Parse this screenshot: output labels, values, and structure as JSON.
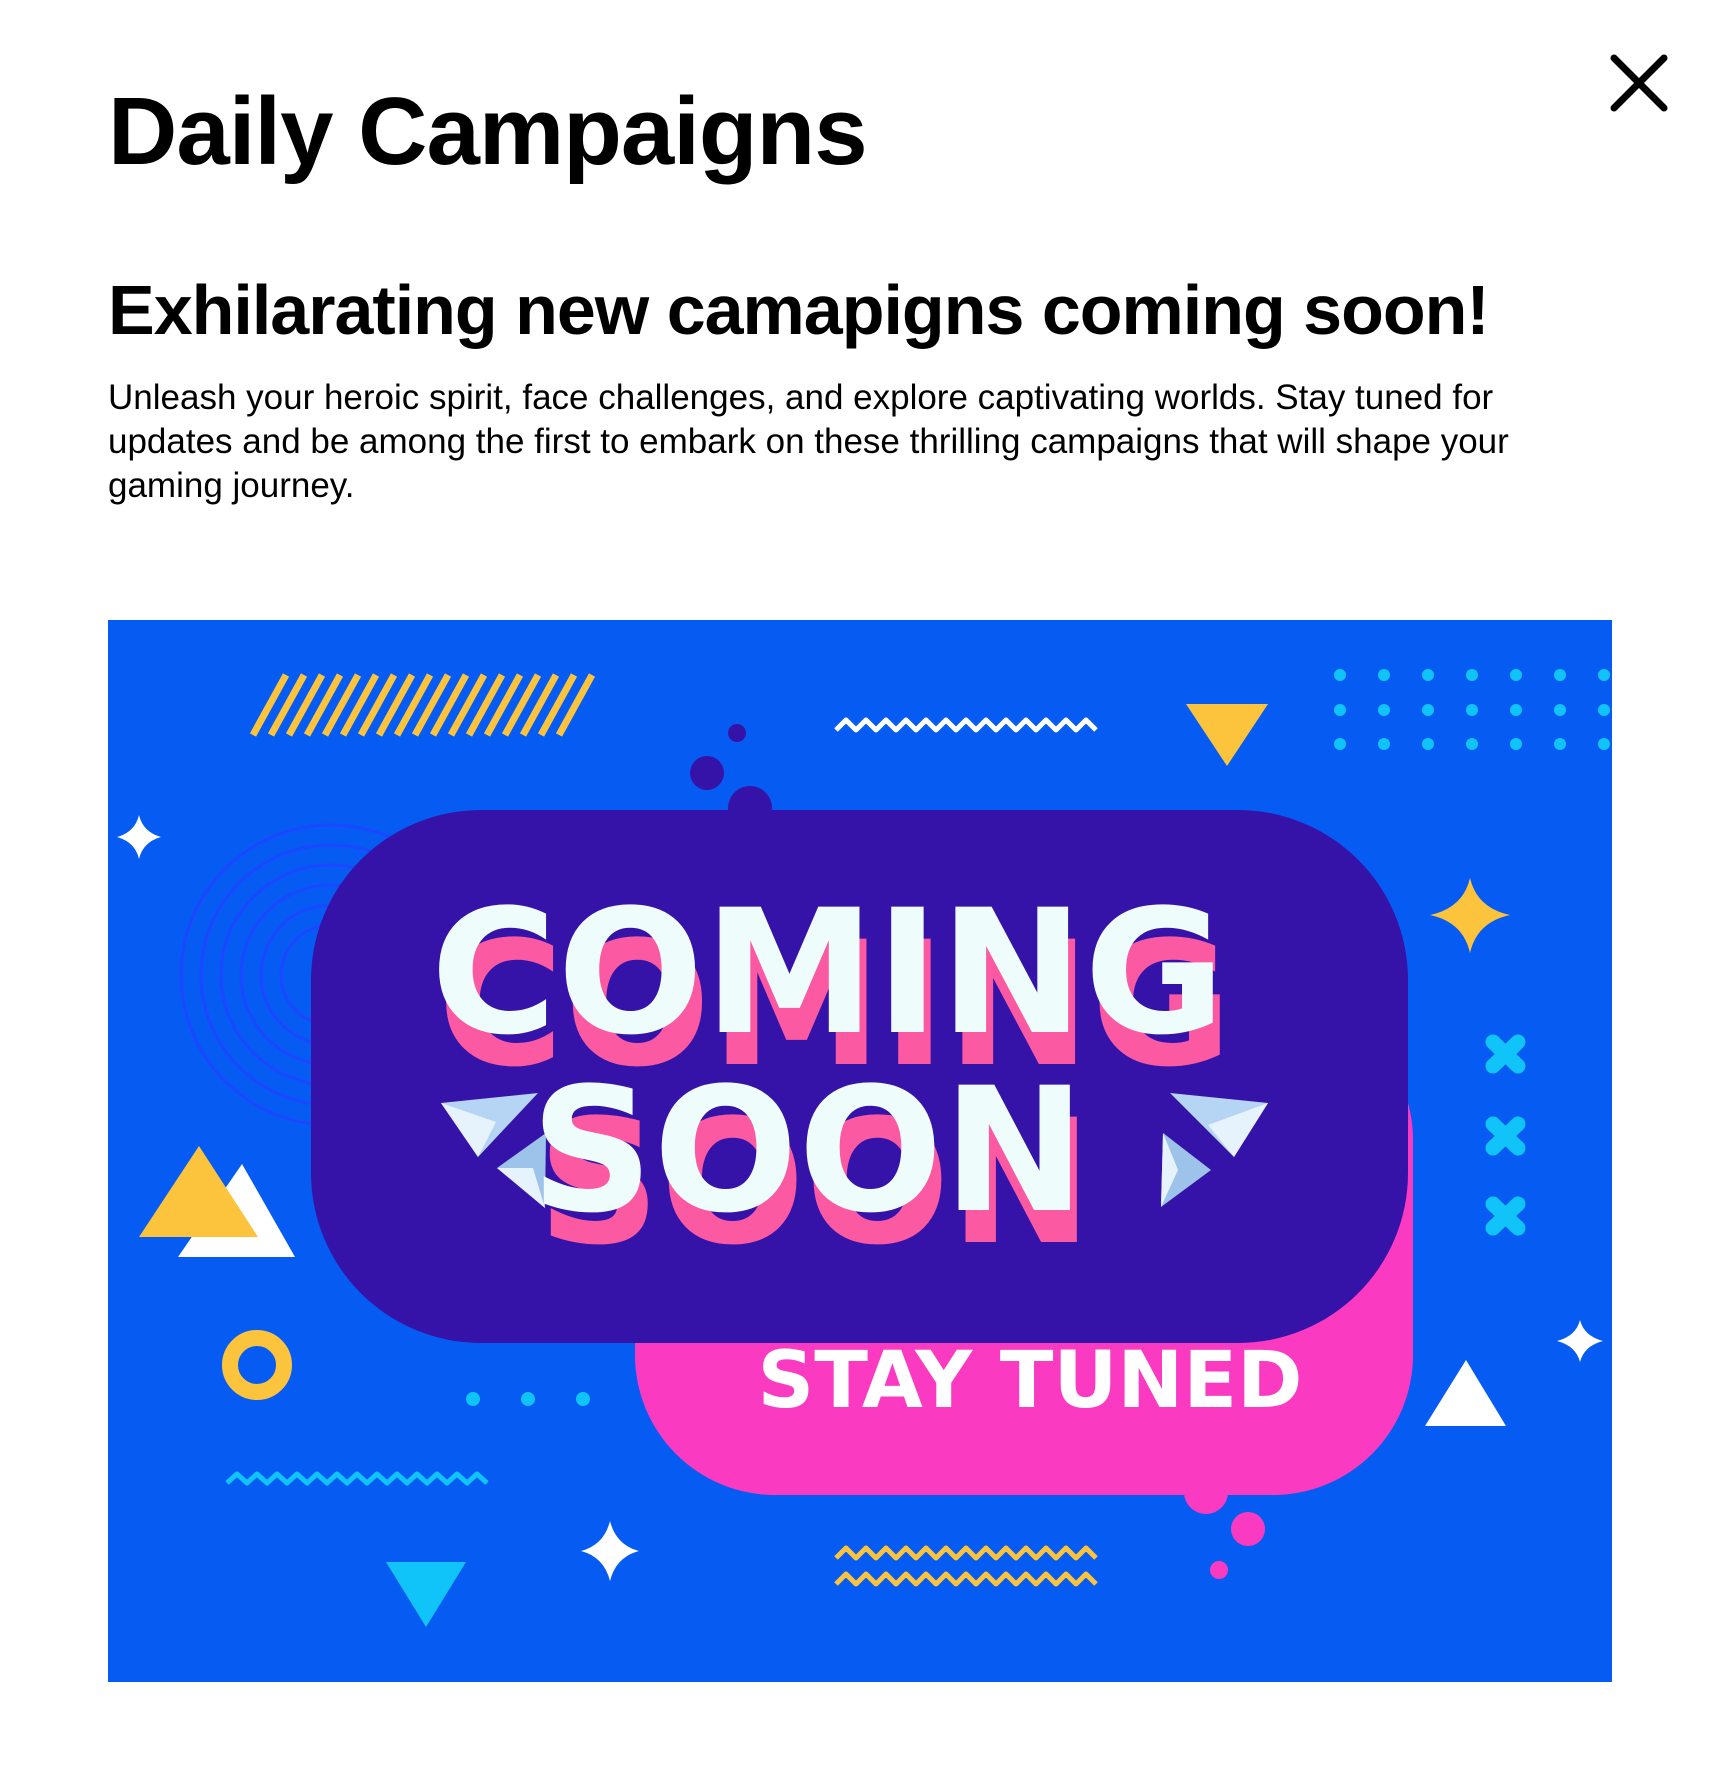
{
  "header": {
    "title": "Daily Campaigns",
    "close_icon": "close-icon"
  },
  "content": {
    "heading": "Exhilarating new camapigns coming soon!",
    "description": "Unleash your heroic spirit, face challenges, and explore captivating worlds. Stay tuned for updates and be among the first to embark on these thrilling campaigns that will shape your gaming journey."
  },
  "banner": {
    "line1": "COMING",
    "line2": "SOON",
    "tagline": "STAY TUNED",
    "colors": {
      "background": "#065cf2",
      "bubble_primary": "#3613a8",
      "bubble_secondary": "#fb3ac2",
      "text_face": "#eefcfb",
      "text_shadow": "#fb5aa3",
      "accent_yellow": "#fcc33c",
      "accent_cyan": "#10c4fa"
    }
  }
}
